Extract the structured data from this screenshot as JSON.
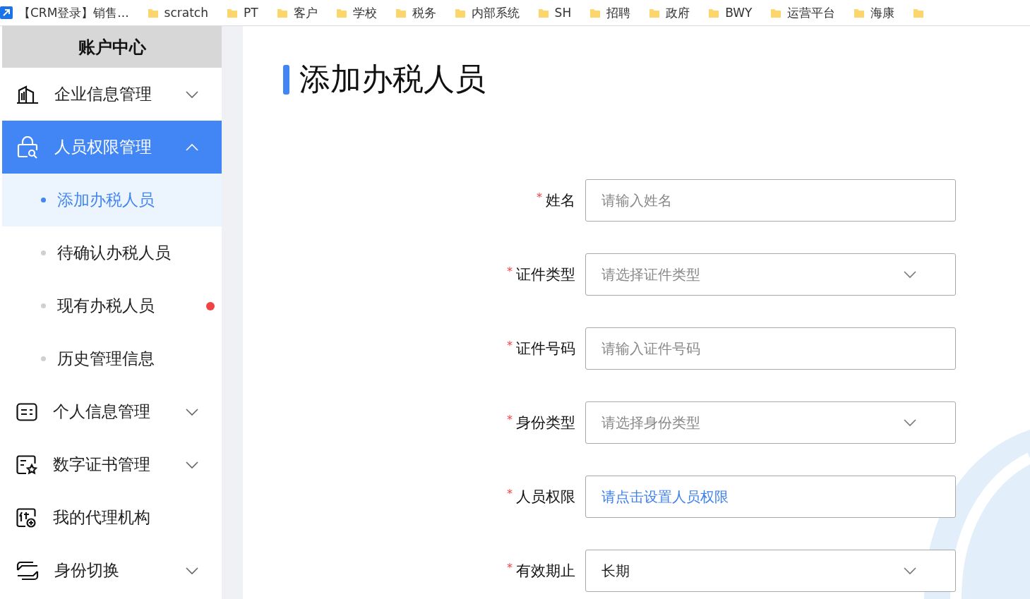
{
  "bookmarks": [
    {
      "kind": "link",
      "label": "【CRM登录】销售..."
    },
    {
      "kind": "folder",
      "label": "scratch"
    },
    {
      "kind": "folder",
      "label": "PT"
    },
    {
      "kind": "folder",
      "label": "客户"
    },
    {
      "kind": "folder",
      "label": "学校"
    },
    {
      "kind": "folder",
      "label": "税务"
    },
    {
      "kind": "folder",
      "label": "内部系统"
    },
    {
      "kind": "folder",
      "label": "SH"
    },
    {
      "kind": "folder",
      "label": "招聘"
    },
    {
      "kind": "folder",
      "label": "政府"
    },
    {
      "kind": "folder",
      "label": "BWY"
    },
    {
      "kind": "folder",
      "label": "运营平台"
    },
    {
      "kind": "folder",
      "label": "海康"
    },
    {
      "kind": "folder"
    }
  ],
  "sidebar": {
    "title": "账户中心",
    "items": [
      {
        "label": "企业信息管理",
        "expanded": false,
        "selected": false
      },
      {
        "label": "人员权限管理",
        "expanded": true,
        "selected": true,
        "children": [
          {
            "label": "添加办税人员",
            "selected": true,
            "alert": false
          },
          {
            "label": "待确认办税人员",
            "selected": false,
            "alert": false
          },
          {
            "label": "现有办税人员",
            "selected": false,
            "alert": true
          },
          {
            "label": "历史管理信息",
            "selected": false,
            "alert": false
          }
        ]
      },
      {
        "label": "个人信息管理",
        "expanded": false,
        "selected": false
      },
      {
        "label": "数字证书管理",
        "expanded": false,
        "selected": false
      },
      {
        "label": "我的代理机构",
        "selected": false
      },
      {
        "label": "身份切换",
        "expanded": false,
        "selected": false
      }
    ]
  },
  "page": {
    "title": "添加办税人员",
    "fields": [
      {
        "required_mark": "*",
        "label": "姓名",
        "kind": "input",
        "placeholder": "请输入姓名"
      },
      {
        "required_mark": "*",
        "label": "证件类型",
        "kind": "select",
        "placeholder": "请选择证件类型"
      },
      {
        "required_mark": "*",
        "label": "证件号码",
        "kind": "input",
        "placeholder": "请输入证件号码"
      },
      {
        "required_mark": "*",
        "label": "身份类型",
        "kind": "select",
        "placeholder": "请选择身份类型"
      },
      {
        "required_mark": "*",
        "label": "人员权限",
        "kind": "link",
        "link": "请点击设置人员权限"
      },
      {
        "required_mark": "*",
        "label": "有效期止",
        "kind": "select",
        "value": "长期"
      }
    ]
  }
}
